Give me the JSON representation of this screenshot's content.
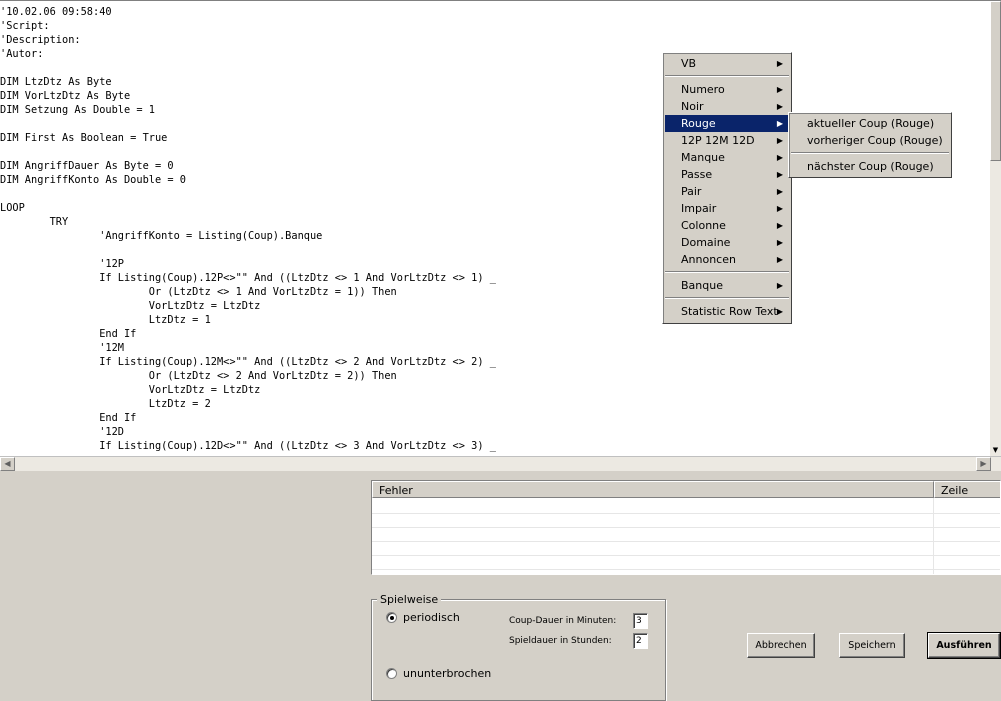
{
  "editor": {
    "lines": [
      "'10.02.06 09:58:40",
      "'Script:",
      "'Description:",
      "'Autor:",
      "",
      "DIM LtzDtz As Byte",
      "DIM VorLtzDtz As Byte",
      "DIM Setzung As Double = 1",
      "",
      "DIM First As Boolean = True",
      "",
      "DIM AngriffDauer As Byte = 0",
      "DIM AngriffKonto As Double = 0",
      "",
      "LOOP",
      "        TRY",
      "                'AngriffKonto = Listing(Coup).Banque",
      "",
      "                '12P",
      "                If Listing(Coup).12P<>\"\" And ((LtzDtz <> 1 And VorLtzDtz <> 1) _",
      "                        Or (LtzDtz <> 1 And VorLtzDtz = 1)) Then",
      "                        VorLtzDtz = LtzDtz",
      "                        LtzDtz = 1",
      "                End If",
      "                '12M",
      "                If Listing(Coup).12M<>\"\" And ((LtzDtz <> 2 And VorLtzDtz <> 2) _",
      "                        Or (LtzDtz <> 2 And VorLtzDtz = 2)) Then",
      "                        VorLtzDtz = LtzDtz",
      "                        LtzDtz = 2",
      "                End If",
      "                '12D",
      "                If Listing(Coup).12D<>\"\" And ((LtzDtz <> 3 And VorLtzDtz <> 3) _"
    ]
  },
  "context_menu": {
    "items": [
      {
        "label": "VB",
        "submenu": true
      },
      {
        "separator": true
      },
      {
        "label": "Numero",
        "submenu": true
      },
      {
        "label": "Noir",
        "submenu": true
      },
      {
        "label": "Rouge",
        "submenu": true,
        "selected": true
      },
      {
        "label": "12P 12M 12D",
        "submenu": true
      },
      {
        "label": "Manque",
        "submenu": true
      },
      {
        "label": "Passe",
        "submenu": true
      },
      {
        "label": "Pair",
        "submenu": true
      },
      {
        "label": "Impair",
        "submenu": true
      },
      {
        "label": "Colonne",
        "submenu": true
      },
      {
        "label": "Domaine",
        "submenu": true
      },
      {
        "label": "Annoncen",
        "submenu": true
      },
      {
        "separator": true
      },
      {
        "label": "Banque",
        "submenu": true
      },
      {
        "separator": true
      },
      {
        "label": "Statistic Row Text",
        "submenu": true
      }
    ],
    "submenu_rouge": {
      "current": "aktueller Coup (Rouge)",
      "previous": "vorheriger Coup (Rouge)",
      "next": "nächster Coup (Rouge)"
    }
  },
  "error_list": {
    "col_error": "Fehler",
    "col_line": "Zeile",
    "rows": []
  },
  "playmode": {
    "title": "Spielweise",
    "periodic_label": "periodisch",
    "continuous_label": "ununterbrochen",
    "selected": "periodisch",
    "coup_duration_label": "Coup-Dauer in Minuten:",
    "coup_duration_value": "3",
    "play_duration_label": "Spieldauer in Stunden:",
    "play_duration_value": "2"
  },
  "buttons": {
    "cancel": "Abbrechen",
    "save": "Speichern",
    "run": "Ausführen"
  },
  "colors": {
    "menu_highlight": "#0a246a",
    "dialog_bg": "#d4d0c8"
  }
}
